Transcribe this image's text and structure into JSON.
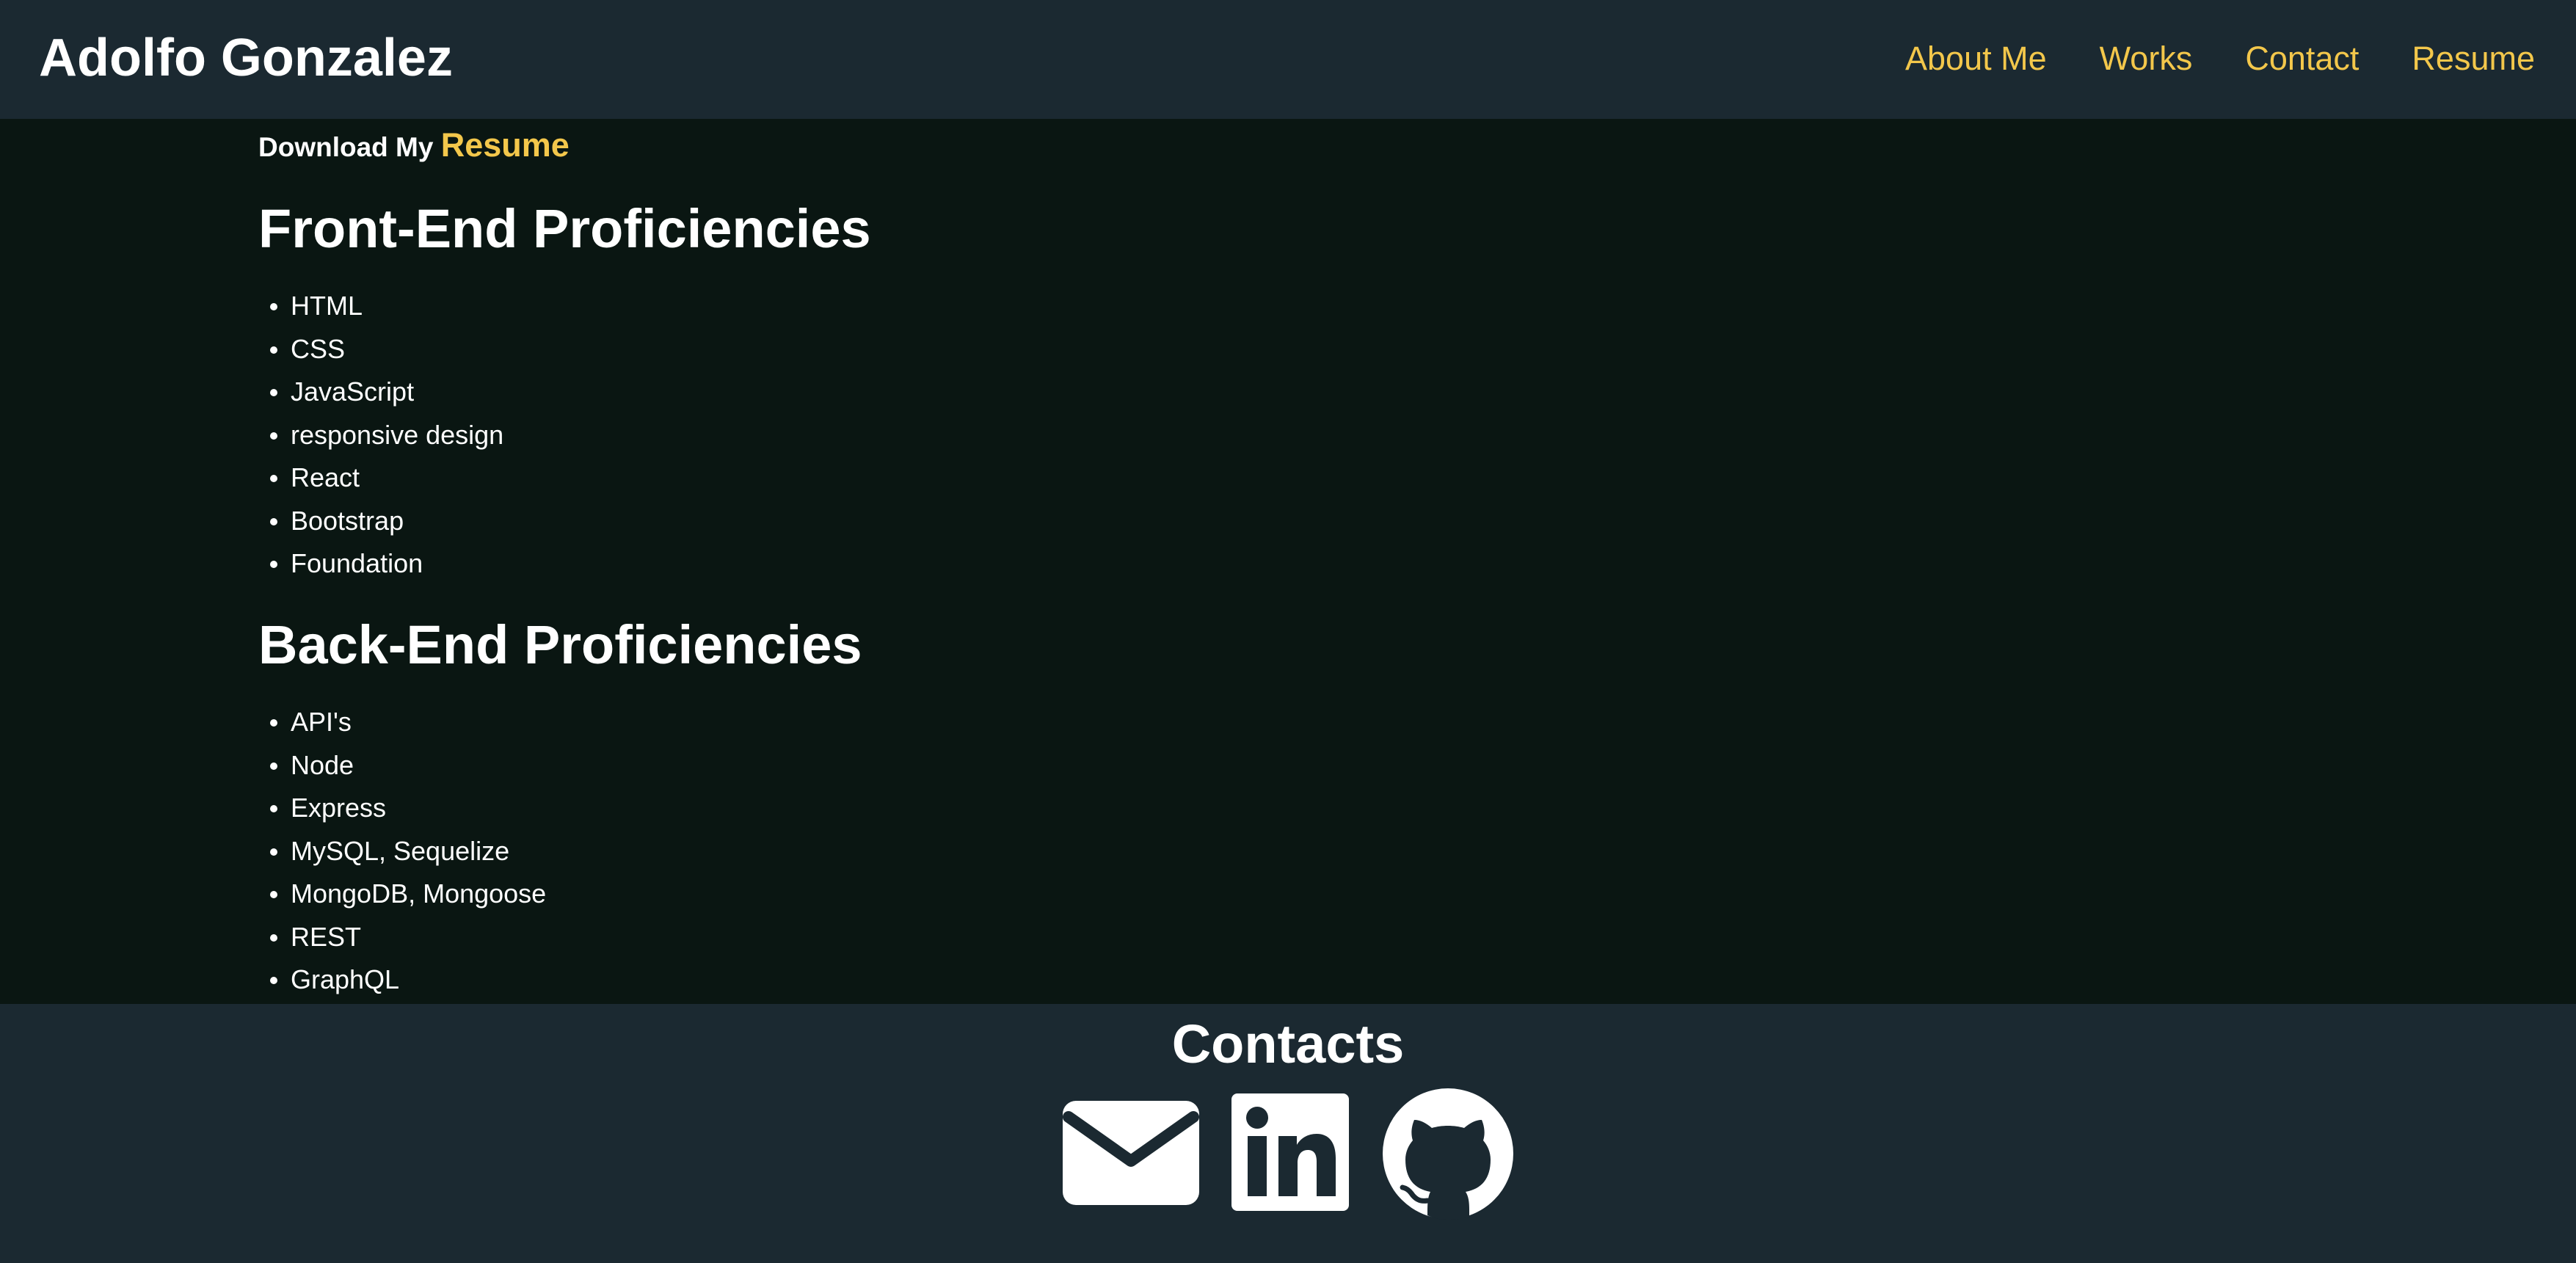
{
  "header": {
    "brand": "Adolfo Gonzalez",
    "nav": [
      {
        "label": "About Me"
      },
      {
        "label": "Works"
      },
      {
        "label": "Contact"
      },
      {
        "label": "Resume"
      }
    ]
  },
  "main": {
    "download_prefix": "Download My",
    "download_link": "Resume",
    "frontend": {
      "title": "Front-End Proficiencies",
      "items": [
        "HTML",
        "CSS",
        "JavaScript",
        "responsive design",
        "React",
        "Bootstrap",
        "Foundation"
      ]
    },
    "backend": {
      "title": "Back-End Proficiencies",
      "items": [
        "API's",
        "Node",
        "Express",
        "MySQL, Sequelize",
        "MongoDB, Mongoose",
        "REST",
        "GraphQL"
      ]
    }
  },
  "footer": {
    "title": "Contacts",
    "icons": [
      "envelope-icon",
      "linkedin-icon",
      "github-icon"
    ]
  },
  "colors": {
    "header_bg": "#1b2931",
    "main_bg": "#0a1612",
    "accent": "#f3c74b",
    "text": "#ffffff"
  }
}
